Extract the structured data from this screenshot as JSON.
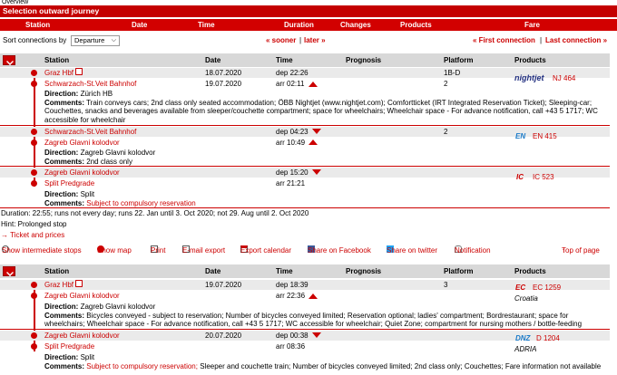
{
  "page": {
    "top_label": "Overview",
    "title": "Selection outward journey"
  },
  "colheads": {
    "station": "Station",
    "date": "Date",
    "time": "Time",
    "duration": "Duration",
    "changes": "Changes",
    "products": "Products",
    "fare": "Fare"
  },
  "sort": {
    "label": "Sort connections by",
    "value": "Departure",
    "sooner": "« sooner",
    "later": "later »",
    "first": "« First connection",
    "last": "Last connection »",
    "divider": "|"
  },
  "grid_head": {
    "station": "Station",
    "date": "Date",
    "time": "Time",
    "prognosis": "Prognosis",
    "platform": "Platform",
    "products": "Products"
  },
  "c1": {
    "s1": {
      "from": "Graz Hbf",
      "to": "Schwarzach-St.Veit Bahnhof",
      "date1": "18.07.2020",
      "date2": "19.07.2020",
      "dep": "dep 22:26",
      "arr": "arr 02:11",
      "plat1": "1B-D",
      "plat2": "2",
      "product_logo": "nightjet",
      "product": "NJ 464",
      "direction_label": "Direction:",
      "direction": "Zürich HB",
      "comments_label": "Comments:",
      "comments": "Train conveys cars; 2nd class only seated accommodation; ÖBB Nightjet (www.nightjet.com); Comfortticket (IRT Integrated Reservation Ticket); Sleeping-car; Couchettes, snacks and beverages available from sleeper/couchette compartment; space for wheelchairs; Wheelchair space - For advance notification, call +43 5 1717; WC accessible for wheelchair"
    },
    "s2": {
      "from": "Schwarzach-St.Veit Bahnhof",
      "to": "Zagreb Glavni kolodvor",
      "dep": "dep 04:23",
      "arr": "arr 10:49",
      "plat1": "2",
      "product_logo": "EN",
      "product": "EN 415",
      "direction_label": "Direction:",
      "direction": "Zagreb Glavni kolodvor",
      "comments_label": "Comments:",
      "comments": "2nd class only"
    },
    "s3": {
      "from": "Zagreb Glavni kolodvor",
      "to": "Split Predgrade",
      "dep": "dep 15:20",
      "arr": "arr 21:21",
      "product_logo": "IC",
      "product": "IC 523",
      "direction_label": "Direction:",
      "direction": "Split",
      "comments_label": "Comments:",
      "comments": "Subject to compulsory reservation"
    },
    "duration": "Duration: 22:55; runs not every day; runs 22. Jan until 3. Oct 2020; not 29. Aug until 2. Oct 2020",
    "hint": "Hint: Prolonged stop",
    "tickets": "Ticket and prices"
  },
  "toolbar": {
    "intermediate": "Show intermediate stops",
    "map": "Show map",
    "print": "Print",
    "email": "E-mail export",
    "calendar": "Export calendar",
    "facebook": "Share on Facebook",
    "twitter": "Share on twitter",
    "notification": "Notification",
    "top": "Top of page"
  },
  "c2": {
    "s1": {
      "from": "Graz Hbf",
      "to": "Zagreb Glavni kolodvor",
      "date1": "19.07.2020",
      "dep": "dep 18:39",
      "arr": "arr 22:36",
      "plat1": "3",
      "product_logo": "EC",
      "product": "EC 1259",
      "product_name": "Croatia",
      "direction_label": "Direction:",
      "direction": "Zagreb Glavni kolodvor",
      "comments_label": "Comments:",
      "comments": "Bicycles conveyed - subject to reservation; Number of bicycles conveyed limited; Reservation optional; ladies' compartment; Bordrestaurant; space for wheelchairs; Wheelchair space - For advance notification, call +43 5 1717; WC accessible for wheelchair; Quiet Zone; compartment for nursing mothers / bottle-feeding"
    },
    "s2": {
      "from": "Zagreb Glavni kolodvor",
      "to": "Split Predgrade",
      "date1": "20.07.2020",
      "dep": "dep 00:38",
      "arr": "arr 08:36",
      "product_logo": "DNZ",
      "product": "D 1204",
      "product_name": "ADRIA",
      "direction_label": "Direction:",
      "direction": "Split",
      "comments_label": "Comments:",
      "comments_red": "Subject to compulsory reservation;",
      "comments": " Sleeper and couchette train; Number of bicycles conveyed limited; 2nd class only; Couchettes; Fare information not available"
    }
  },
  "colors": {
    "brand": "#c40000",
    "header_grey": "#d8d8d8",
    "row_grey": "#eaeaea"
  }
}
